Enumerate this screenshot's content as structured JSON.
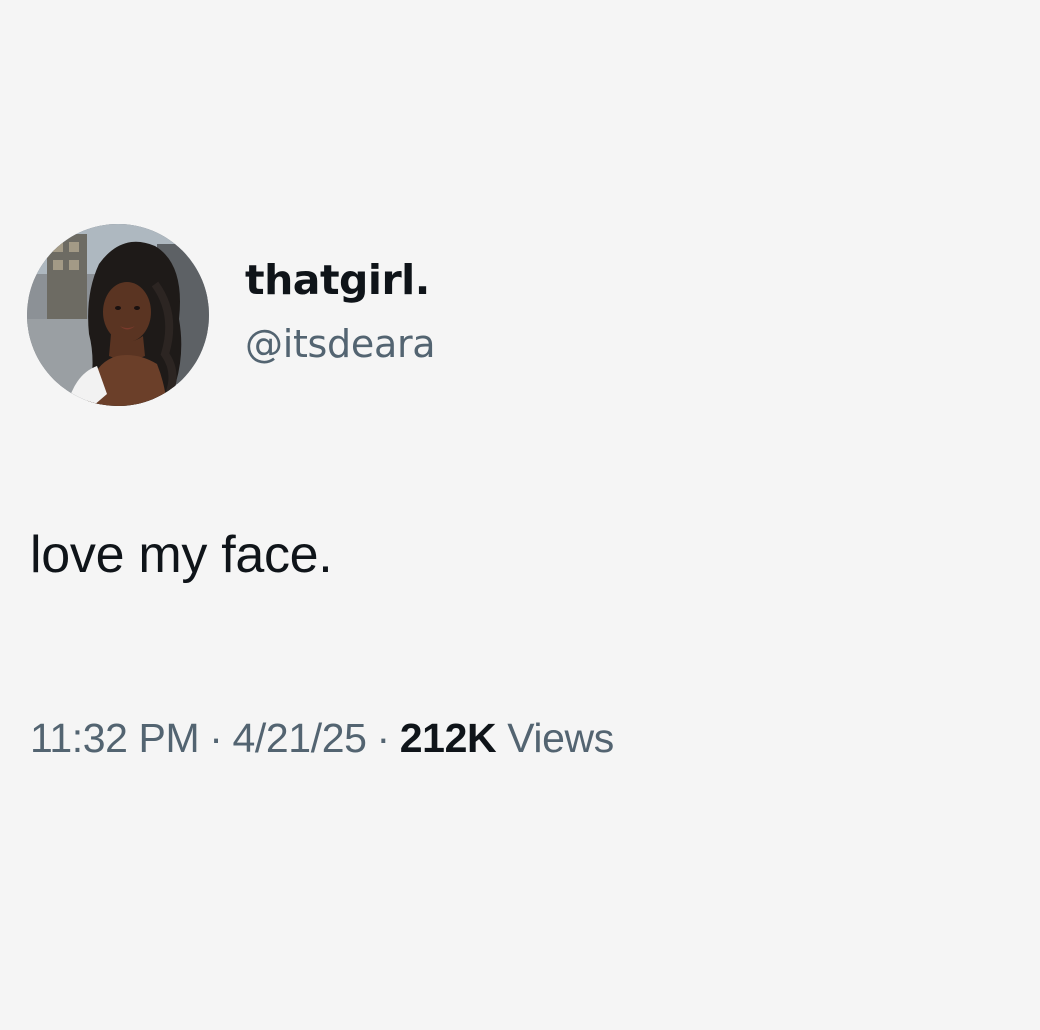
{
  "tweet": {
    "display_name": "thatgirl.",
    "handle": "@itsdeara",
    "text": "love my face.",
    "time": "11:32 PM",
    "date": "4/21/25",
    "separator": "·",
    "views_count": "212K",
    "views_label": "Views"
  }
}
